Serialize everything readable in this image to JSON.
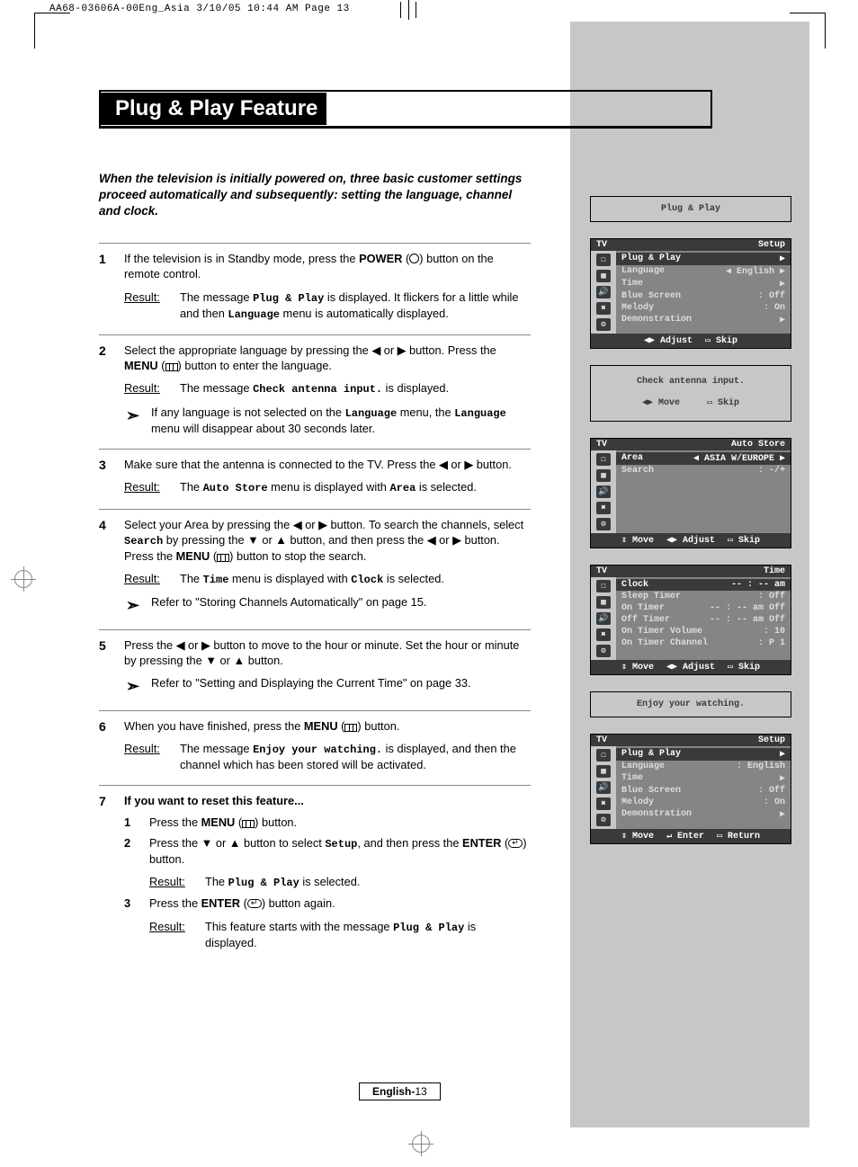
{
  "slug": "AA68-03606A-00Eng_Asia  3/10/05  10:44 AM  Page 13",
  "title": "Plug & Play Feature",
  "intro": "When the television is initially powered on, three basic customer settings proceed automatically and subsequently: setting the language, channel and clock.",
  "steps": [
    {
      "num": "1",
      "text_pre": "If the television is in Standby mode, press the ",
      "btn1": "POWER",
      "text_post": " button on the remote control.",
      "result_label": "Result:",
      "result_text_a": "The message ",
      "result_mono1": "Plug & Play",
      "result_text_b": " is displayed. It flickers for a little while and then ",
      "result_mono2": "Language",
      "result_text_c": " menu is automatically displayed."
    },
    {
      "num": "2",
      "text_a": "Select the appropriate language by pressing the ◀ or ▶ button. Press the ",
      "btn1": "MENU",
      "text_b": " button to enter the language.",
      "result_label": "Result:",
      "result_text_a": "The message ",
      "result_mono1": "Check antenna input.",
      "result_text_b": " is displayed.",
      "note_text_a": "If any language is not selected on the ",
      "note_mono1": "Language",
      "note_text_b": " menu, the ",
      "note_mono2": "Language",
      "note_text_c": " menu will disappear about 30 seconds later."
    },
    {
      "num": "3",
      "text": "Make sure that the antenna is connected to the TV. Press the ◀ or ▶ button.",
      "result_label": "Result:",
      "result_text_a": "The ",
      "result_mono1": "Auto Store",
      "result_text_b": " menu is displayed with ",
      "result_mono2": "Area",
      "result_text_c": " is selected."
    },
    {
      "num": "4",
      "text_a": "Select your Area by pressing the ◀ or ▶ button. To search the channels, select ",
      "mono1": "Search",
      "text_b": " by pressing the ▼ or ▲ button, and then press the ◀ or ▶ button. Press the ",
      "btn1": "MENU",
      "text_c": " button to stop the search.",
      "result_label": "Result:",
      "result_text_a": "The ",
      "result_mono1": "Time",
      "result_text_b": " menu is displayed with ",
      "result_mono2": "Clock",
      "result_text_c": " is selected.",
      "note_text": "Refer to \"Storing Channels Automatically\" on page 15."
    },
    {
      "num": "5",
      "text": "Press the ◀ or ▶ button to move to the hour or minute. Set the hour or minute by pressing the ▼ or ▲ button.",
      "note_text": "Refer to \"Setting and Displaying the Current Time\" on page 33."
    },
    {
      "num": "6",
      "text_a": "When you have finished, press the ",
      "btn1": "MENU",
      "text_b": " button.",
      "result_label": "Result:",
      "result_text_a": "The message ",
      "result_mono1": "Enjoy your watching.",
      "result_text_b": " is displayed, and then the channel which has been stored will be activated."
    },
    {
      "num": "7",
      "heading": "If you want to reset this feature...",
      "subs": [
        {
          "n": "1",
          "text_a": "Press the ",
          "btn1": "MENU",
          "text_b": " button."
        },
        {
          "n": "2",
          "text_a": "Press the ▼ or ▲ button to select ",
          "mono1": "Setup",
          "text_b": ", and then press the ",
          "btn1": "ENTER",
          "text_c": " button.",
          "result_label": "Result:",
          "result_text_a": "The ",
          "result_mono1": "Plug & Play",
          "result_text_b": " is selected."
        },
        {
          "n": "3",
          "text_a": "Press the ",
          "btn1": "ENTER",
          "text_b": " button again.",
          "result_label": "Result:",
          "result_text_a": "This feature starts with the message ",
          "result_mono1": "Plug & Play",
          "result_text_b": " is displayed."
        }
      ]
    }
  ],
  "osd": {
    "pp_title": "Plug & Play",
    "setup1": {
      "hdr_l": "TV",
      "hdr_r": "Setup",
      "rows": [
        {
          "k": "Plug & Play",
          "v": "▶",
          "hi": true
        },
        {
          "k": "Language",
          "v": "◀ English      ▶"
        },
        {
          "k": "Time",
          "v": "▶"
        },
        {
          "k": "Blue Screen",
          "v": ": Off"
        },
        {
          "k": "Melody",
          "v": ": On"
        },
        {
          "k": "Demonstration",
          "v": "▶"
        }
      ],
      "footer": [
        "◀▶ Adjust",
        "▭ Skip"
      ]
    },
    "check": {
      "msg": "Check antenna input.",
      "footer": [
        "◀▶ Move",
        "▭ Skip"
      ]
    },
    "auto": {
      "hdr_l": "TV",
      "hdr_r": "Auto Store",
      "rows": [
        {
          "k": "Area",
          "v": "◀ ASIA W/EUROPE ▶",
          "hi": true
        },
        {
          "k": "Search",
          "v": ": -/+"
        }
      ],
      "footer": [
        "⇕ Move",
        "◀▶ Adjust",
        "▭ Skip"
      ]
    },
    "time": {
      "hdr_l": "TV",
      "hdr_r": "Time",
      "rows": [
        {
          "k": "Clock",
          "v": "-- : --  am",
          "hi": true
        },
        {
          "k": "Sleep Timer",
          "v": ": Off"
        },
        {
          "k": "On Timer",
          "v": "-- : -- am Off"
        },
        {
          "k": "Off Timer",
          "v": "-- : -- am Off"
        },
        {
          "k": "On Timer Volume",
          "v": ": 10"
        },
        {
          "k": "On Timer Channel",
          "v": ": P 1"
        }
      ],
      "footer": [
        "⇕ Move",
        "◀▶ Adjust",
        "▭ Skip"
      ]
    },
    "enjoy": {
      "msg": "Enjoy your watching."
    },
    "setup2": {
      "hdr_l": "TV",
      "hdr_r": "Setup",
      "rows": [
        {
          "k": "Plug & Play",
          "v": "▶",
          "hi": true
        },
        {
          "k": "Language",
          "v": ": English"
        },
        {
          "k": "Time",
          "v": "▶"
        },
        {
          "k": "Blue Screen",
          "v": ": Off"
        },
        {
          "k": "Melody",
          "v": ": On"
        },
        {
          "k": "Demonstration",
          "v": "▶"
        }
      ],
      "footer": [
        "⇕ Move",
        "↵ Enter",
        "▭ Return"
      ]
    }
  },
  "pagenum_prefix": "English-",
  "pagenum": "13"
}
